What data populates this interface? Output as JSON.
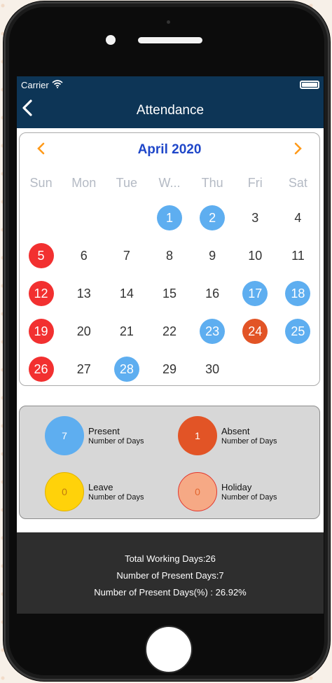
{
  "status_bar": {
    "carrier": "Carrier"
  },
  "nav": {
    "title": "Attendance",
    "back_icon": "chevron-left-icon"
  },
  "calendar": {
    "month_title": "April 2020",
    "weekdays": [
      "Sun",
      "Mon",
      "Tue",
      "W...",
      "Thu",
      "Fri",
      "Sat"
    ],
    "days": [
      {
        "d": ""
      },
      {
        "d": ""
      },
      {
        "d": ""
      },
      {
        "d": "1",
        "s": "present"
      },
      {
        "d": "2",
        "s": "present"
      },
      {
        "d": "3"
      },
      {
        "d": "4"
      },
      {
        "d": "5",
        "s": "holiday"
      },
      {
        "d": "6"
      },
      {
        "d": "7"
      },
      {
        "d": "8"
      },
      {
        "d": "9"
      },
      {
        "d": "10"
      },
      {
        "d": "11"
      },
      {
        "d": "12",
        "s": "holiday"
      },
      {
        "d": "13"
      },
      {
        "d": "14"
      },
      {
        "d": "15"
      },
      {
        "d": "16"
      },
      {
        "d": "17",
        "s": "present"
      },
      {
        "d": "18",
        "s": "present"
      },
      {
        "d": "19",
        "s": "holiday"
      },
      {
        "d": "20"
      },
      {
        "d": "21"
      },
      {
        "d": "22"
      },
      {
        "d": "23",
        "s": "present"
      },
      {
        "d": "24",
        "s": "absent"
      },
      {
        "d": "25",
        "s": "present"
      },
      {
        "d": "26",
        "s": "holiday"
      },
      {
        "d": "27"
      },
      {
        "d": "28",
        "s": "present"
      },
      {
        "d": "29"
      },
      {
        "d": "30"
      },
      {
        "d": ""
      },
      {
        "d": ""
      }
    ]
  },
  "summary": {
    "present": {
      "count": "7",
      "label": "Present",
      "sub": "Number of Days",
      "color": "#5eaef0"
    },
    "absent": {
      "count": "1",
      "label": "Absent",
      "sub": "Number of Days",
      "color": "#e25426"
    },
    "leave": {
      "count": "0",
      "label": "Leave",
      "sub": "Number of Days",
      "color": "#ffd20a"
    },
    "holiday": {
      "count": "0",
      "label": "Holiday",
      "sub": "Number of Days",
      "color": "#f6a985"
    }
  },
  "footer": {
    "total_working": "Total Working Days:26",
    "present_days": "Number of Present Days:7",
    "present_pct": "Number of Present Days(%) : 26.92%"
  }
}
